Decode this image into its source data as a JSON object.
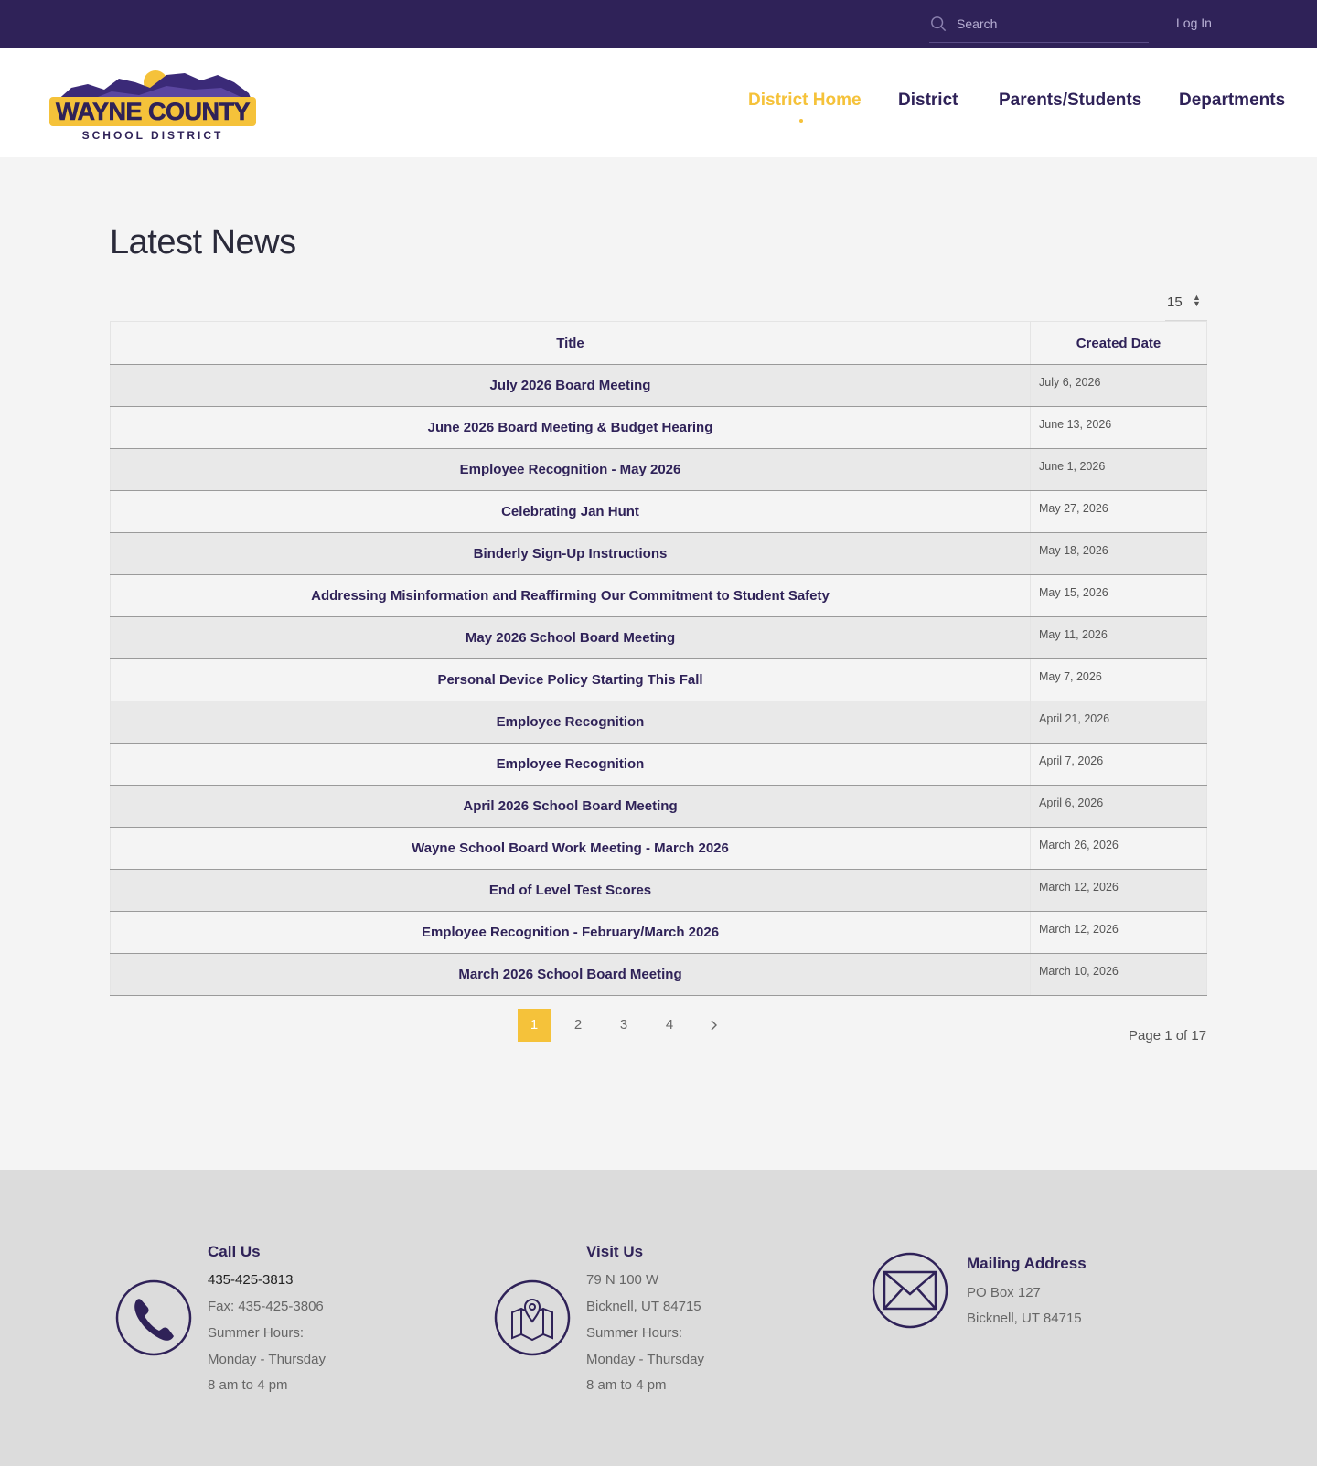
{
  "topbar": {
    "search_placeholder": "Search",
    "login_label": "Log In"
  },
  "header": {
    "logo": {
      "line1": "WAYNE COUNTY",
      "line2": "SCHOOL DISTRICT"
    },
    "nav": [
      {
        "label": "District Home",
        "active": true
      },
      {
        "label": "District",
        "active": false
      },
      {
        "label": "Parents/Students",
        "active": false
      },
      {
        "label": "Departments",
        "active": false
      }
    ]
  },
  "main": {
    "title": "Latest News",
    "per_page": "15",
    "table": {
      "headers": {
        "title": "Title",
        "date": "Created Date"
      },
      "rows": [
        {
          "title": "July 2026 Board Meeting",
          "date": "July 6, 2026"
        },
        {
          "title": "June 2026 Board Meeting & Budget Hearing",
          "date": "June 13, 2026"
        },
        {
          "title": "Employee Recognition - May 2026",
          "date": "June 1, 2026"
        },
        {
          "title": "Celebrating Jan Hunt",
          "date": "May 27, 2026"
        },
        {
          "title": "Binderly Sign-Up Instructions",
          "date": "May 18, 2026"
        },
        {
          "title": "Addressing Misinformation and Reaffirming Our Commitment to Student Safety",
          "date": "May 15, 2026"
        },
        {
          "title": "May 2026 School Board Meeting",
          "date": "May 11, 2026"
        },
        {
          "title": "Personal Device Policy Starting This Fall",
          "date": "May 7, 2026"
        },
        {
          "title": "Employee Recognition",
          "date": "April 21, 2026"
        },
        {
          "title": "Employee Recognition",
          "date": "April 7, 2026"
        },
        {
          "title": "April 2026 School Board Meeting",
          "date": "April 6, 2026"
        },
        {
          "title": "Wayne School Board Work Meeting - March 2026",
          "date": "March 26, 2026"
        },
        {
          "title": "End of Level Test Scores",
          "date": "March 12, 2026"
        },
        {
          "title": "Employee Recognition - February/March 2026",
          "date": "March 12, 2026"
        },
        {
          "title": "March 2026 School Board Meeting",
          "date": "March 10, 2026"
        }
      ]
    },
    "pagination": {
      "pages": [
        "1",
        "2",
        "3",
        "4"
      ],
      "current": "1",
      "next_icon": "chevron-right-icon",
      "page_of": "Page 1 of 17"
    }
  },
  "footer": {
    "call": {
      "icon": "phone-icon",
      "heading": "Call Us",
      "phone": "435-425-3813",
      "fax": "Fax: 435-425-3806",
      "hours_label": "Summer Hours:",
      "days": "Monday - Thursday",
      "hours": "8 am to 4 pm"
    },
    "visit": {
      "icon": "map-pin-icon",
      "heading": "Visit Us",
      "street": "79 N 100 W",
      "city": "Bicknell, UT 84715",
      "hours_label": "Summer Hours:",
      "days": "Monday - Thursday",
      "hours": "8 am to 4 pm"
    },
    "mail": {
      "icon": "envelope-icon",
      "heading": "Mailing Address",
      "box": "PO Box 127",
      "city": "Bicknell, UT 84715"
    }
  },
  "colors": {
    "brand_purple": "#2f2258",
    "accent_gold": "#f5c23a"
  }
}
